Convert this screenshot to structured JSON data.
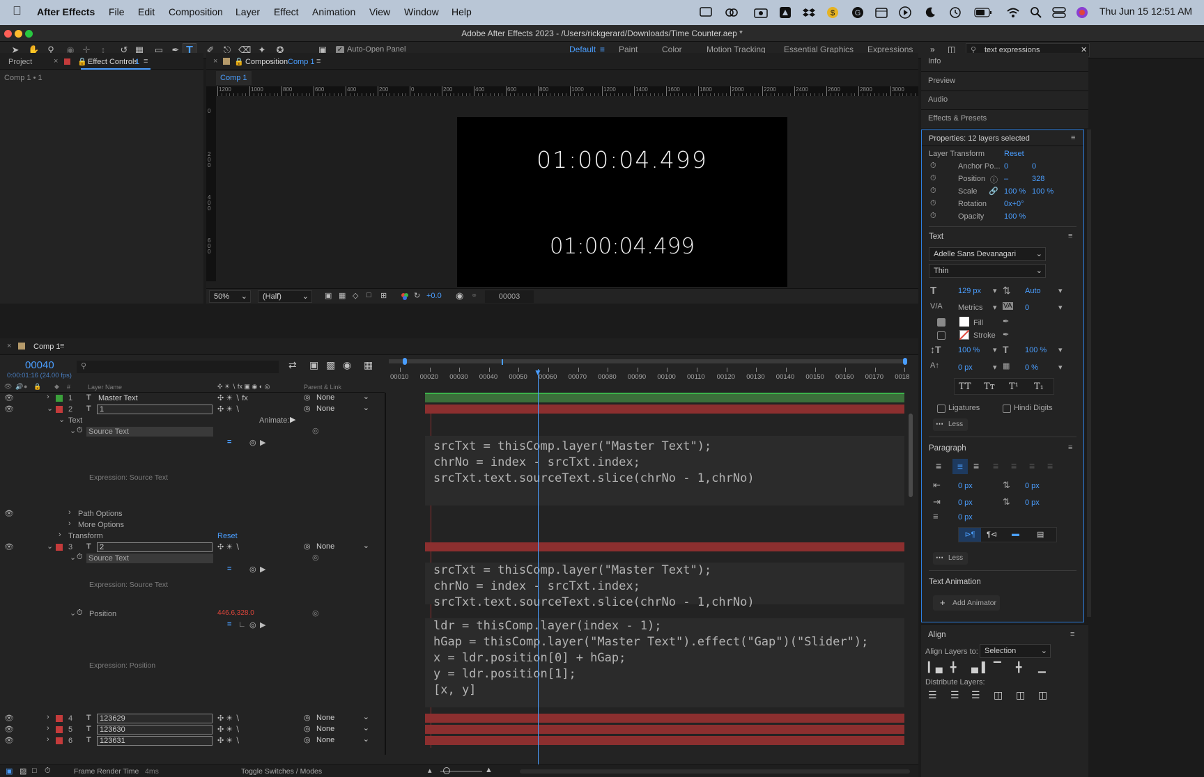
{
  "menubar": {
    "app": "After Effects",
    "items": [
      "File",
      "Edit",
      "Composition",
      "Layer",
      "Effect",
      "Animation",
      "View",
      "Window",
      "Help"
    ],
    "clock": "Thu Jun 15  12:51 AM"
  },
  "window": {
    "title": "Adobe After Effects 2023 - /Users/rickgerard/Downloads/Time Counter.aep *"
  },
  "toolbar": {
    "auto_open": "Auto-Open Panel",
    "workspaces": [
      "Default",
      "Paint",
      "Color",
      "Motion Tracking",
      "Essential Graphics",
      "Expressions"
    ],
    "search": "text expressions"
  },
  "left_panel": {
    "tab_project": "Project",
    "tab_effect": "Effect Controls",
    "tab_effect_num": "1",
    "subtitle": "Comp 1 • 1"
  },
  "comp_panel": {
    "tab_label": "Composition",
    "tab_comp": "Comp 1",
    "subtab": "Comp 1",
    "ruler": [
      "1200",
      "1000",
      "800",
      "600",
      "400",
      "200",
      "0",
      "200",
      "400",
      "600",
      "800",
      "1000",
      "1200",
      "1400",
      "1600",
      "1800",
      "2000",
      "2200",
      "2400",
      "2600",
      "2800",
      "3000"
    ],
    "vruler": [
      "0",
      "200",
      "400",
      "600",
      "800"
    ],
    "text_top": "01:00:04.499",
    "text_bottom": "01:00:04.499",
    "zoom": "50%",
    "resolution": "(Half)",
    "exposure": "+0.0",
    "frame": "00003"
  },
  "right_tabs": [
    "Info",
    "Preview",
    "Audio",
    "Effects & Presets"
  ],
  "properties": {
    "header": "Properties: 12 layers selected",
    "layer_transform": "Layer Transform",
    "reset": "Reset",
    "anchor_label": "Anchor Po...",
    "anchor_x": "0",
    "anchor_y": "0",
    "position_label": "Position",
    "position_x": "–",
    "position_y": "328",
    "scale_label": "Scale",
    "scale_x": "100 %",
    "scale_y": "100 %",
    "rotation_label": "Rotation",
    "rotation": "0x+0°",
    "opacity_label": "Opacity",
    "opacity": "100 %",
    "text_head": "Text",
    "font": "Adelle Sans Devanagari",
    "style": "Thin",
    "font_size": "129 px",
    "leading": "Auto",
    "kerning": "Metrics",
    "tracking": "0",
    "fill": "Fill",
    "stroke": "Stroke",
    "vscale": "100 %",
    "hscale": "100 %",
    "baseline": "0 px",
    "tsume": "0 %",
    "caps": [
      "TT",
      "Tт",
      "T¹",
      "T₁"
    ],
    "ligatures": "Ligatures",
    "hindi_digits": "Hindi Digits",
    "less": "Less",
    "paragraph_head": "Paragraph",
    "indent1": "0 px",
    "indent2": "0 px",
    "indent3": "0 px",
    "indent4": "0 px",
    "indent5": "0 px",
    "less2": "Less",
    "text_animation": "Text Animation",
    "add_animator": "Add Animator"
  },
  "align": {
    "head": "Align",
    "align_to_label": "Align Layers to:",
    "align_to": "Selection",
    "distribute": "Distribute Layers:"
  },
  "timeline": {
    "tab": "Comp 1",
    "timecode": "00040",
    "timecode_sub": "0:00:01:16 (24.00 fps)",
    "col_layer_name": "Layer Name",
    "col_parent": "Parent & Link",
    "ticks": [
      "00010",
      "00020",
      "00030",
      "00040",
      "00050",
      "00060",
      "00070",
      "00080",
      "00090",
      "00100",
      "00110",
      "00120",
      "00130",
      "00140",
      "00150",
      "00160",
      "00170",
      "0018"
    ],
    "layers": [
      {
        "num": "1",
        "name": "Master Text",
        "parent": "None"
      },
      {
        "num": "2",
        "name": "1",
        "parent": "None"
      },
      {
        "num": "3",
        "name": "2",
        "parent": "None"
      },
      {
        "num": "4",
        "name": "123629",
        "parent": "None"
      },
      {
        "num": "5",
        "name": "123630",
        "parent": "None"
      },
      {
        "num": "6",
        "name": "123631",
        "parent": "None"
      }
    ],
    "text_group": "Text",
    "animate": "Animate:",
    "source_text": "Source Text",
    "expr_source": "Expression: Source Text",
    "path_options": "Path Options",
    "more_options": "More Options",
    "transform": "Transform",
    "transform_reset": "Reset",
    "position": "Position",
    "position_value": "446.6,328.0",
    "expr_position": "Expression: Position",
    "code1": [
      "srcTxt = thisComp.layer(\"Master Text\");",
      "chrNo = index - srcTxt.index;",
      "srcTxt.text.sourceText.slice(chrNo - 1,chrNo)"
    ],
    "code2": [
      "srcTxt = thisComp.layer(\"Master Text\");",
      "chrNo = index - srcTxt.index;",
      "srcTxt.text.sourceText.slice(chrNo - 1,chrNo)"
    ],
    "code3": [
      "ldr = thisComp.layer(index - 1);",
      "hGap = thisComp.layer(\"Master Text\").effect(\"Gap\")(\"Slider\");",
      "x = ldr.position[0] + hGap;",
      "y = ldr.position[1];",
      "[x, y]"
    ],
    "footer_render": "Frame Render Time",
    "footer_render_val": "4ms",
    "footer_toggle": "Toggle Switches / Modes"
  }
}
